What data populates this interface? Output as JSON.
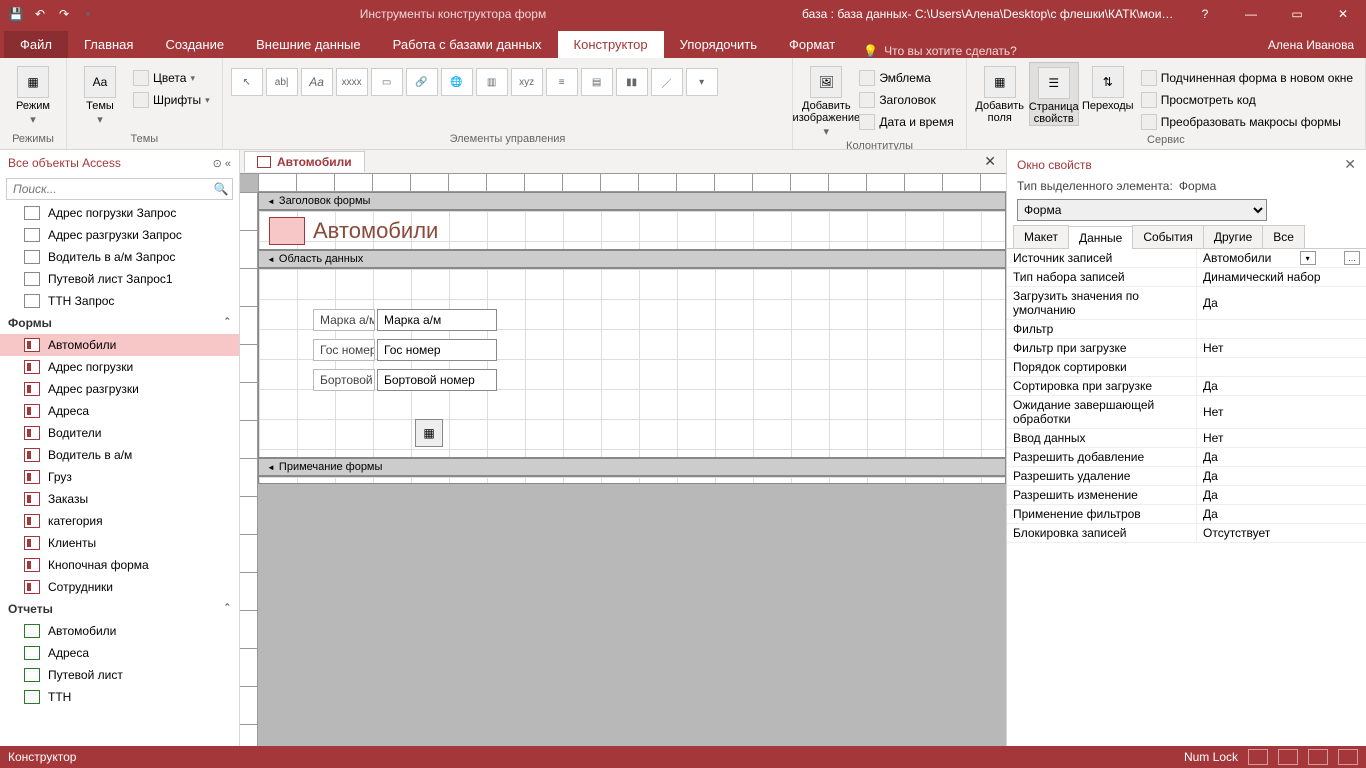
{
  "titlebar": {
    "tools_label": "Инструменты конструктора форм",
    "db_label": "база : база данных- C:\\Users\\Алена\\Desktop\\с флешки\\КАТК\\мои р..."
  },
  "tabs": {
    "file": "Файл",
    "home": "Главная",
    "create": "Создание",
    "external": "Внешние данные",
    "dbtools": "Работа с базами данных",
    "design": "Конструктор",
    "arrange": "Упорядочить",
    "format": "Формат",
    "tellme_placeholder": "Что вы хотите сделать?",
    "user": "Алена Иванова"
  },
  "ribbon": {
    "g1": {
      "view": "Режим",
      "label": "Режимы"
    },
    "g2": {
      "themes": "Темы",
      "colors": "Цвета",
      "fonts": "Шрифты",
      "label": "Темы"
    },
    "g3": {
      "label": "Элементы управления"
    },
    "g4": {
      "img": "Добавить\nизображение",
      "logo": "Эмблема",
      "title": "Заголовок",
      "datetime": "Дата и время",
      "label": "Колонтитулы"
    },
    "g5": {
      "addfields": "Добавить\nполя",
      "prop": "Страница\nсвойств",
      "taborder": "Переходы",
      "subform": "Подчиненная форма в новом окне",
      "viewcode": "Просмотреть код",
      "convert": "Преобразовать макросы формы",
      "label": "Сервис"
    }
  },
  "nav": {
    "title": "Все объекты Access",
    "search_placeholder": "Поиск...",
    "queries": [
      "Адрес погрузки Запрос",
      "Адрес разгрузки Запрос",
      "Водитель в а/м Запрос",
      "Путевой лист Запрос1",
      "ТТН Запрос"
    ],
    "forms_hdr": "Формы",
    "forms": [
      "Автомобили",
      "Адрес погрузки",
      "Адрес разгрузки",
      "Адреса",
      "Водители",
      "Водитель в а/м",
      "Груз",
      "Заказы",
      "категория",
      "Клиенты",
      "Кнопочная форма",
      "Сотрудники"
    ],
    "reports_hdr": "Отчеты",
    "reports": [
      "Автомобили",
      "Адреса",
      "Путевой лист",
      "ТТН"
    ]
  },
  "doc": {
    "tab_name": "Автомобили",
    "sec_header": "Заголовок формы",
    "sec_detail": "Область данных",
    "sec_footer": "Примечание формы",
    "form_title": "Автомобили",
    "fields": [
      {
        "label": "Марка а/м",
        "ctrl": "Марка а/м"
      },
      {
        "label": "Гос номер",
        "ctrl": "Гос номер"
      },
      {
        "label": "Бортовой",
        "ctrl": "Бортовой номер"
      }
    ]
  },
  "props": {
    "title": "Окно свойств",
    "subtitle_prefix": "Тип выделенного элемента:",
    "subtitle_type": "Форма",
    "selector_value": "Форма",
    "tabs": {
      "layout": "Макет",
      "data": "Данные",
      "events": "События",
      "other": "Другие",
      "all": "Все"
    },
    "rows": [
      {
        "n": "Источник записей",
        "v": "Автомобили",
        "dd": true
      },
      {
        "n": "Тип набора записей",
        "v": "Динамический набор"
      },
      {
        "n": "Загрузить значения по умолчанию",
        "v": "Да"
      },
      {
        "n": "Фильтр",
        "v": ""
      },
      {
        "n": "Фильтр при загрузке",
        "v": "Нет"
      },
      {
        "n": "Порядок сортировки",
        "v": ""
      },
      {
        "n": "Сортировка при загрузке",
        "v": "Да"
      },
      {
        "n": "Ожидание завершающей обработки",
        "v": "Нет"
      },
      {
        "n": "Ввод данных",
        "v": "Нет"
      },
      {
        "n": "Разрешить добавление",
        "v": "Да"
      },
      {
        "n": "Разрешить удаление",
        "v": "Да"
      },
      {
        "n": "Разрешить изменение",
        "v": "Да"
      },
      {
        "n": "Применение фильтров",
        "v": "Да"
      },
      {
        "n": "Блокировка записей",
        "v": "Отсутствует"
      }
    ]
  },
  "status": {
    "left": "Конструктор",
    "numlock": "Num Lock"
  }
}
